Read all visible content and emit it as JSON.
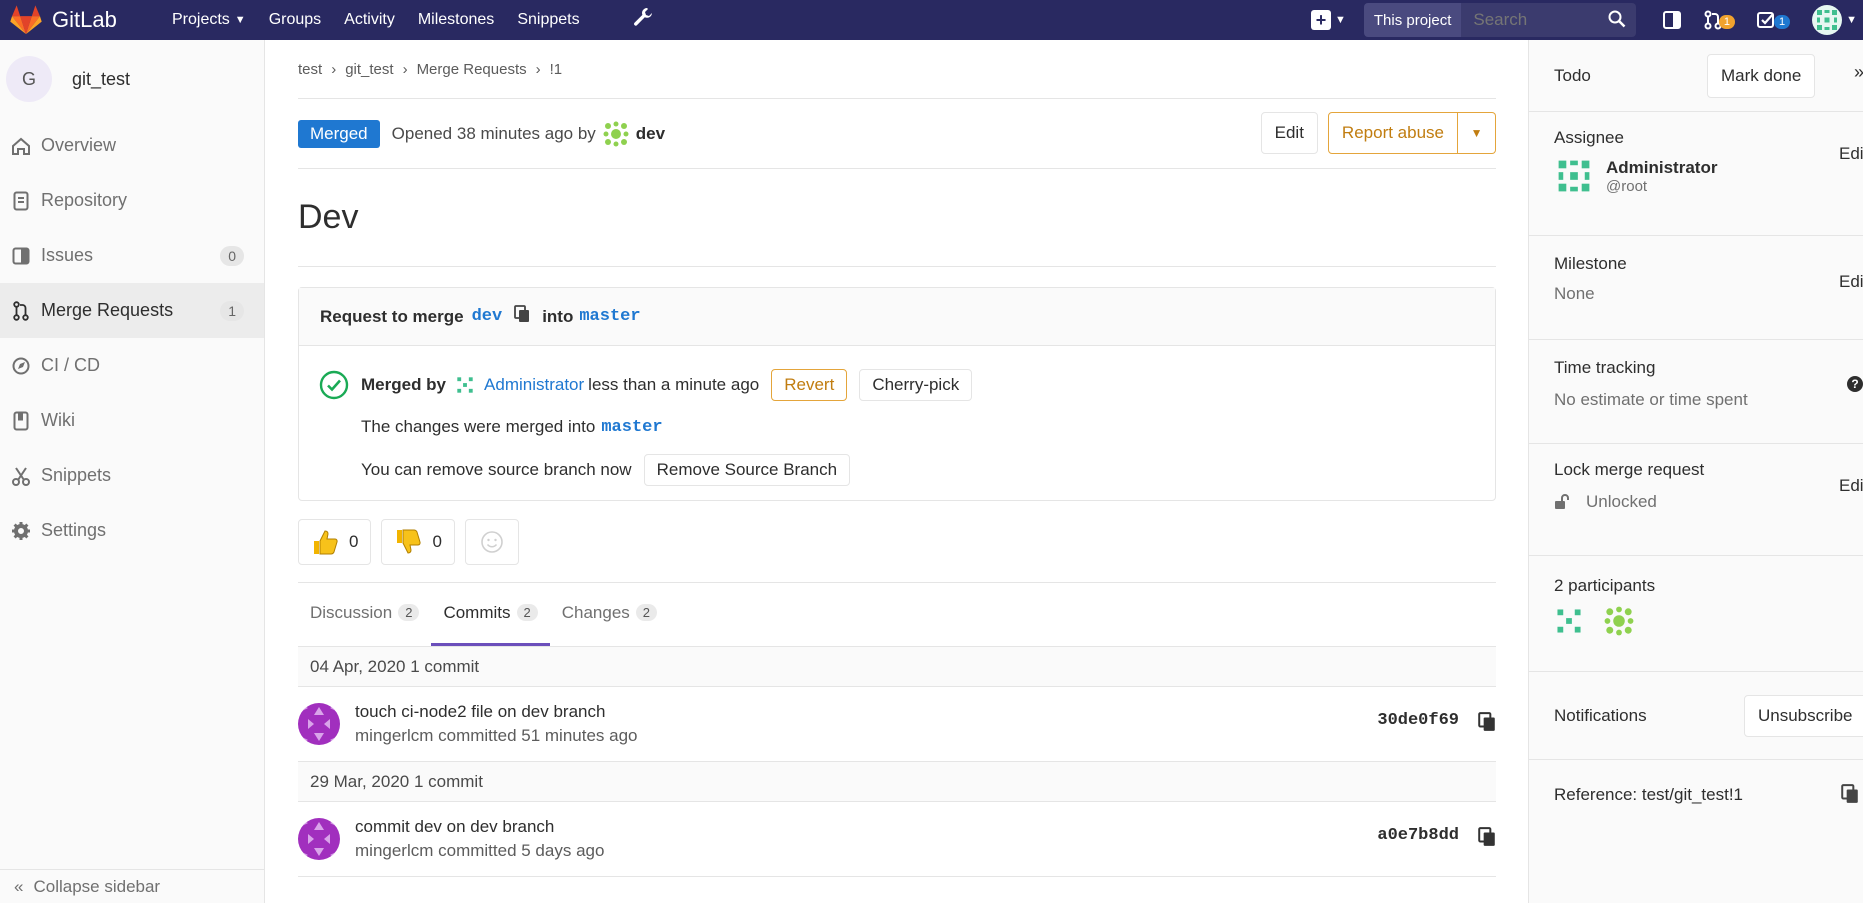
{
  "topbar": {
    "brand": "GitLab",
    "nav": [
      "Projects",
      "Groups",
      "Activity",
      "Milestones",
      "Snippets"
    ],
    "search_scope": "This project",
    "search_placeholder": "Search",
    "mr_badge": "1",
    "todo_badge": "1"
  },
  "sidebar": {
    "project_initial": "G",
    "project_name": "git_test",
    "items": [
      {
        "label": "Overview",
        "icon": "home-icon"
      },
      {
        "label": "Repository",
        "icon": "repository-icon"
      },
      {
        "label": "Issues",
        "icon": "issues-icon",
        "count": "0"
      },
      {
        "label": "Merge Requests",
        "icon": "merge-request-icon",
        "count": "1"
      },
      {
        "label": "CI / CD",
        "icon": "rocket-icon"
      },
      {
        "label": "Wiki",
        "icon": "book-icon"
      },
      {
        "label": "Snippets",
        "icon": "scissors-icon"
      },
      {
        "label": "Settings",
        "icon": "gear-icon"
      }
    ],
    "collapse": "Collapse sidebar"
  },
  "breadcrumb": [
    "test",
    "git_test",
    "Merge Requests",
    "!1"
  ],
  "mr": {
    "status": "Merged",
    "opened_text": "Opened 38 minutes ago by",
    "author": "dev",
    "edit": "Edit",
    "report": "Report abuse",
    "title": "Dev"
  },
  "widget": {
    "request_prefix": "Request to merge",
    "source": "dev",
    "into": "into",
    "target": "master",
    "merged_by": "Merged by",
    "merger": "Administrator",
    "merged_when": "less than a minute ago",
    "revert": "Revert",
    "cherry_pick": "Cherry-pick",
    "changes_msg": "The changes were merged into",
    "remove_msg": "You can remove source branch now",
    "remove_btn": "Remove Source Branch"
  },
  "awards": {
    "up": "0",
    "down": "0"
  },
  "tabs": [
    {
      "label": "Discussion",
      "count": "2"
    },
    {
      "label": "Commits",
      "count": "2"
    },
    {
      "label": "Changes",
      "count": "2"
    }
  ],
  "commits": [
    {
      "date": "04 Apr, 2020 1 commit",
      "title": "touch ci-node2 file on dev branch",
      "meta": "mingerlcm committed 51 minutes ago",
      "sha": "30de0f69"
    },
    {
      "date": "29 Mar, 2020 1 commit",
      "title": "commit dev on dev branch",
      "meta": "mingerlcm committed 5 days ago",
      "sha": "a0e7b8dd"
    }
  ],
  "right": {
    "todo": "Todo",
    "mark_done": "Mark done",
    "assignee_label": "Assignee",
    "edit": "Edit",
    "assignee_name": "Administrator",
    "assignee_user": "@root",
    "milestone_label": "Milestone",
    "milestone_value": "None",
    "time_label": "Time tracking",
    "time_value": "No estimate or time spent",
    "lock_label": "Lock merge request",
    "lock_value": "Unlocked",
    "participants": "2 participants",
    "notifications": "Notifications",
    "unsubscribe": "Unsubscribe",
    "reference": "Reference: test/git_test!1"
  }
}
